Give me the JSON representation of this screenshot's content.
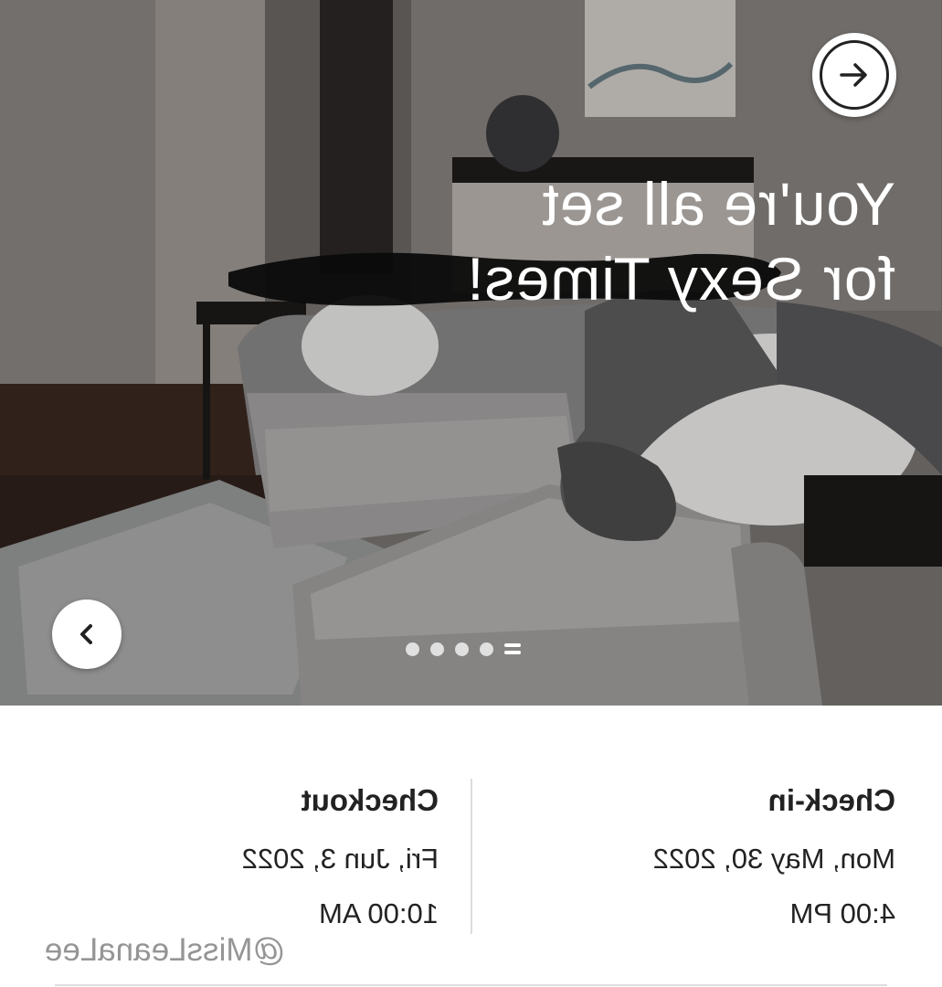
{
  "hero": {
    "title_line1": "You're all set",
    "title_line2": "for Sexy Times!",
    "next_icon": "arrow-right-icon",
    "prev_icon": "chevron-left-icon",
    "carousel_dots": 5,
    "active_dot_index": 0
  },
  "checkin": {
    "label": "Check-in",
    "date": "Mon, May 30, 2022",
    "time": "4:00 PM"
  },
  "checkout": {
    "label": "Checkout",
    "date": "Fri, Jun 3, 2022",
    "time": "10:00 AM"
  },
  "watermark": "@MissLeanaLee",
  "colors": {
    "text": "#222222",
    "divider": "#dddddd",
    "watermark": "#8a8a8a"
  }
}
